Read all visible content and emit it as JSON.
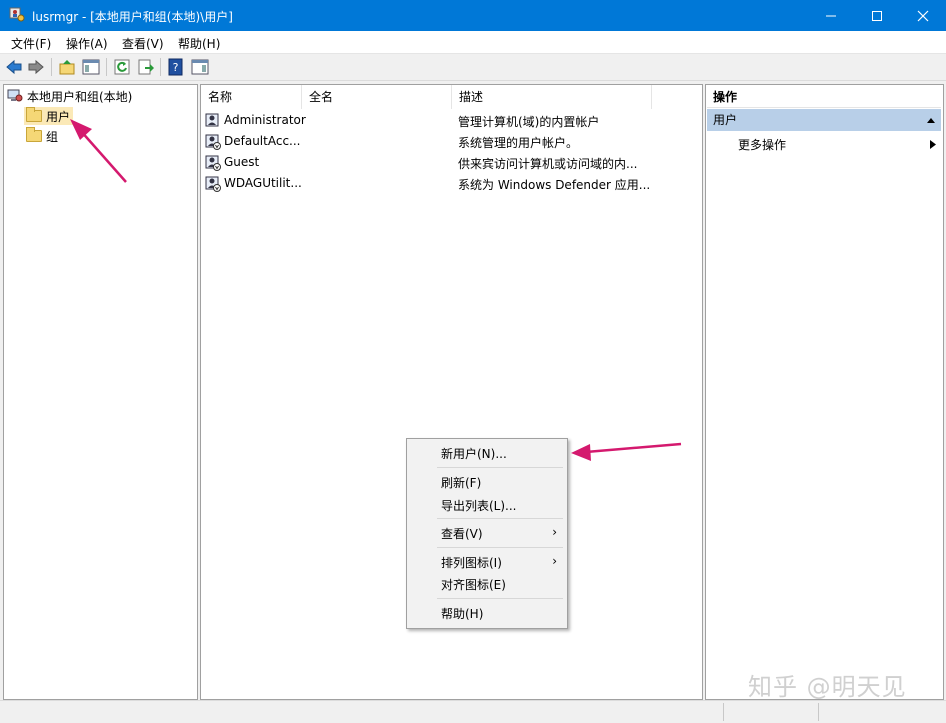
{
  "window": {
    "title": "lusrmgr - [本地用户和组(本地)\\用户]",
    "minimize": "minimize",
    "maximize": "maximize",
    "close": "close"
  },
  "menu": [
    "文件(F)",
    "操作(A)",
    "查看(V)",
    "帮助(H)"
  ],
  "toolbar": [
    "back-arrow-icon",
    "forward-arrow-icon",
    "up-folder-icon",
    "show-hide-tree-icon",
    "refresh-icon",
    "export-list-icon",
    "help-icon",
    "show-hide-action-pane-icon"
  ],
  "tree": {
    "root": "本地用户和组(本地)",
    "items": [
      {
        "label": "用户",
        "selected": true
      },
      {
        "label": "组",
        "selected": false
      }
    ]
  },
  "list": {
    "columns": [
      "名称",
      "全名",
      "描述"
    ],
    "rows": [
      {
        "name": "Administrator",
        "fullname": "",
        "desc": "管理计算机(域)的内置帐户"
      },
      {
        "name": "DefaultAcc...",
        "fullname": "",
        "desc": "系统管理的用户帐户。"
      },
      {
        "name": "Guest",
        "fullname": "",
        "desc": "供来宾访问计算机或访问域的内..."
      },
      {
        "name": "WDAGUtilit...",
        "fullname": "",
        "desc": "系统为 Windows Defender 应用..."
      }
    ]
  },
  "actions": {
    "header": "操作",
    "section": "用户",
    "more": "更多操作"
  },
  "context_menu": {
    "new_user": "新用户(N)...",
    "refresh": "刷新(F)",
    "export": "导出列表(L)...",
    "view": "查看(V)",
    "arrange": "排列图标(I)",
    "align": "对齐图标(E)",
    "help": "帮助(H)"
  },
  "watermark": "知乎 @明天见",
  "colors": {
    "titlebar": "#0078d7",
    "selection": "#fbe9b7",
    "annotation_arrow": "#d4196e",
    "actions_section": "#b8cfe8"
  }
}
